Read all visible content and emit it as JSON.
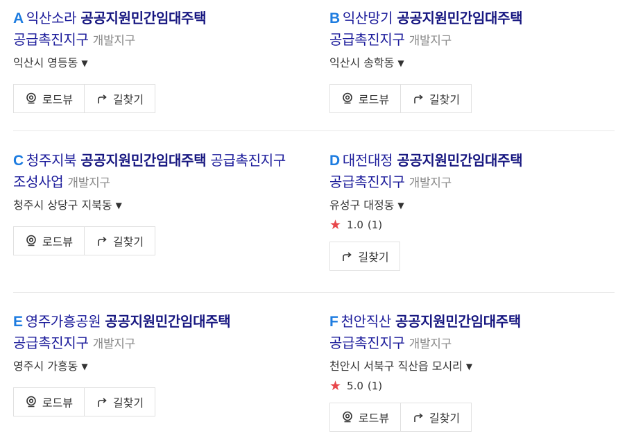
{
  "results": [
    {
      "letter": "A",
      "name": "익산소라",
      "keyword": "공공지원민간임대주택",
      "suffix": "공급촉진지구",
      "category": "개발지구",
      "address": "익산시 영등동",
      "buttons": {
        "roadview": "로드뷰",
        "directions": "길찾기"
      }
    },
    {
      "letter": "B",
      "name": "익산망기",
      "keyword": "공공지원민간임대주택",
      "suffix": "공급촉진지구",
      "category": "개발지구",
      "address": "익산시 송학동",
      "buttons": {
        "roadview": "로드뷰",
        "directions": "길찾기"
      }
    },
    {
      "letter": "C",
      "name": "청주지북",
      "keyword": "공공지원민간임대주택",
      "suffix": "공급촉진지구 조성사업",
      "category": "개발지구",
      "address": "청주시 상당구 지북동",
      "buttons": {
        "roadview": "로드뷰",
        "directions": "길찾기"
      }
    },
    {
      "letter": "D",
      "name": "대전대정",
      "keyword": "공공지원민간임대주택",
      "suffix": "공급촉진지구",
      "category": "개발지구",
      "address": "유성구 대정동",
      "rating": "1.0",
      "review_count": "(1)",
      "buttons": {
        "directions": "길찾기"
      }
    },
    {
      "letter": "E",
      "name": "영주가흥공원",
      "keyword": "공공지원민간임대주택",
      "suffix": "공급촉진지구",
      "category": "개발지구",
      "address": "영주시 가흥동",
      "buttons": {
        "roadview": "로드뷰",
        "directions": "길찾기"
      }
    },
    {
      "letter": "F",
      "name": "천안직산",
      "keyword": "공공지원민간임대주택",
      "suffix": "공급촉진지구",
      "category": "개발지구",
      "address": "천안시 서북구 직산읍 모시리",
      "rating": "5.0",
      "review_count": "(1)",
      "buttons": {
        "roadview": "로드뷰",
        "directions": "길찾기"
      }
    }
  ],
  "icons": {
    "caret": "caret-down-icon",
    "star": "star-icon",
    "roadview": "roadview-camera-icon",
    "directions": "directions-arrow-icon"
  },
  "colors": {
    "letter": "#1d7ce0",
    "title": "#1a1a9a",
    "category": "#888888",
    "star": "#e8474b"
  }
}
